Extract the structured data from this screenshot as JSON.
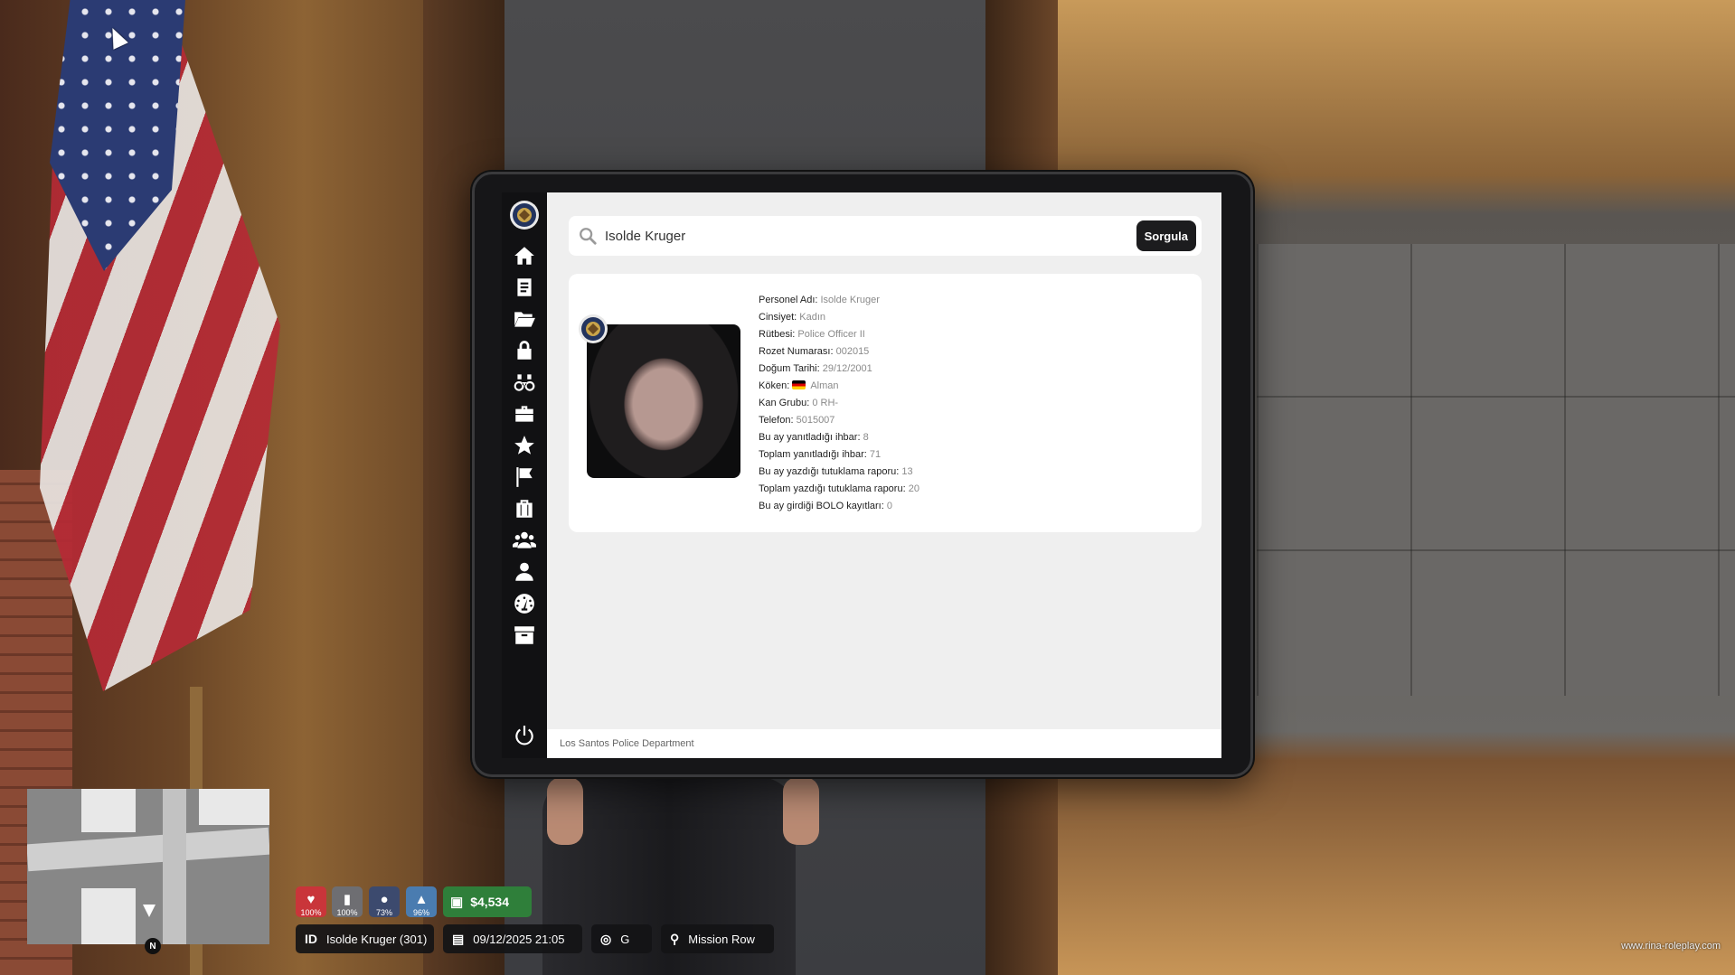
{
  "search": {
    "value": "Isolde Kruger",
    "button_label": "Sorgula"
  },
  "sidebar": {
    "items": [
      {
        "icon": "home-icon"
      },
      {
        "icon": "document-icon"
      },
      {
        "icon": "folder-open-icon"
      },
      {
        "icon": "lock-icon"
      },
      {
        "icon": "binoculars-icon"
      },
      {
        "icon": "briefcase-icon"
      },
      {
        "icon": "star-icon"
      },
      {
        "icon": "flag-icon"
      },
      {
        "icon": "suitcase-icon"
      },
      {
        "icon": "users-icon"
      },
      {
        "icon": "user-icon"
      },
      {
        "icon": "dashboard-icon"
      },
      {
        "icon": "archive-icon"
      }
    ],
    "power_icon": "power-icon"
  },
  "profile": {
    "name_label": "Personel Adı:",
    "name": "Isolde Kruger",
    "gender_label": "Cinsiyet:",
    "gender": "Kadın",
    "rank_label": "Rütbesi:",
    "rank": "Police Officer II",
    "badge_label": "Rozet Numarası:",
    "badge": "002015",
    "birth_label": "Doğum Tarihi:",
    "birth": "29/12/2001",
    "origin_label": "Köken:",
    "origin": "Alman",
    "blood_label": "Kan Grubu:",
    "blood": "0 RH-",
    "phone_label": "Telefon:",
    "phone": "5015007",
    "month_calls_label": "Bu ay yanıtladığı ihbar:",
    "month_calls": "8",
    "total_calls_label": "Toplam yanıtladığı ihbar:",
    "total_calls": "71",
    "month_reports_label": "Bu ay yazdığı tutuklama raporu:",
    "month_reports": "13",
    "total_reports_label": "Toplam yazdığı tutuklama raporu:",
    "total_reports": "20",
    "bolo_label": "Bu ay girdiği BOLO kayıtları:",
    "bolo": "0"
  },
  "footer": {
    "text": "Los Santos Police Department"
  },
  "hud": {
    "health": "100%",
    "armor": "100%",
    "hunger": "73%",
    "thirst": "96%",
    "money": "$4,534",
    "id_icon": "ID",
    "player": "Isolde Kruger (301)",
    "datetime": "09/12/2025 21:05",
    "direction": "G",
    "location": "Mission Row",
    "map_north": "N",
    "watermark": "www.rina-roleplay.com",
    "colors": {
      "health": "#c9353a",
      "armor": "#6e6e72",
      "hunger": "#3c4a6e",
      "thirst": "#4a7cb0",
      "money": "#2f7f3a"
    }
  }
}
